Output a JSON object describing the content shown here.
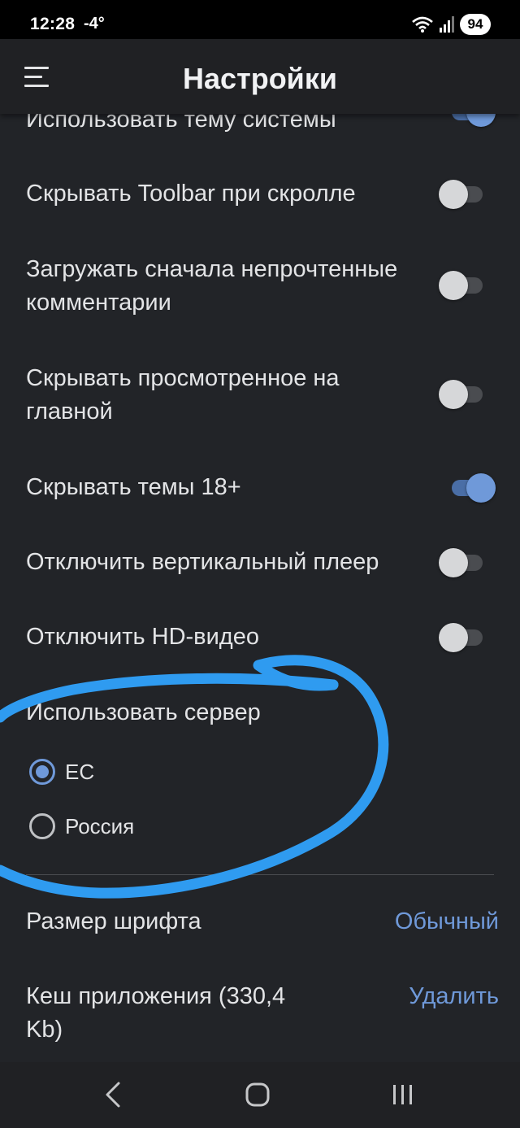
{
  "status_bar": {
    "time": "12:28",
    "temperature": "-4°",
    "battery": "94"
  },
  "header": {
    "title": "Настройки"
  },
  "settings": {
    "system_theme": {
      "label": "Использовать тему системы",
      "enabled": true
    },
    "hide_toolbar": {
      "label": "Скрывать Toolbar при скролле",
      "enabled": false
    },
    "unread_comments": {
      "label": "Загружать сначала непрочтенные комментарии",
      "enabled": false
    },
    "hide_viewed": {
      "label": "Скрывать просмотренное на главной",
      "enabled": false
    },
    "hide_18": {
      "label": "Скрывать темы 18+",
      "enabled": true
    },
    "vertical_player": {
      "label": "Отключить вертикальный плеер",
      "enabled": false
    },
    "hd_video": {
      "label": "Отключить HD-видео",
      "enabled": false
    }
  },
  "server": {
    "label": "Использовать сервер",
    "options": [
      "ЕС",
      "Россия"
    ],
    "selected": "ЕС"
  },
  "font_size": {
    "label": "Размер шрифта",
    "value": "Обычный"
  },
  "cache": {
    "label": "Кеш приложения (330,4 Kb)",
    "action": "Удалить"
  },
  "colors": {
    "accent": "#6f99d9",
    "background": "#222428",
    "annotation_stroke": "#2f9bf0"
  },
  "icons": [
    "menu-icon",
    "wifi-icon",
    "signal-icon",
    "back-icon",
    "home-icon",
    "recents-icon"
  ]
}
